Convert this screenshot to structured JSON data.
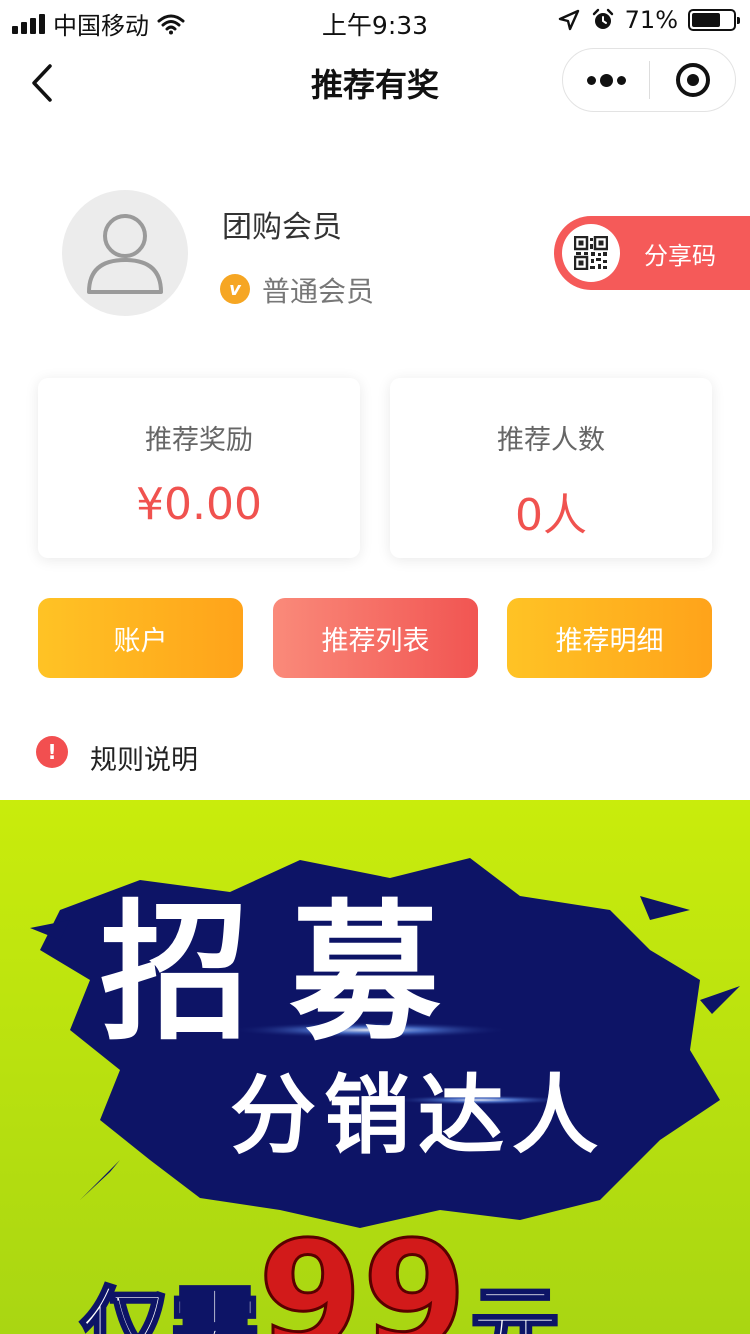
{
  "status_bar": {
    "carrier": "中国移动",
    "time": "上午9:33",
    "battery_percent": "71%",
    "battery_level": 0.71
  },
  "nav": {
    "title": "推荐有奖"
  },
  "profile": {
    "name": "团购会员",
    "badge_letter": "v",
    "member_level": "普通会员",
    "share_code_label": "分享码"
  },
  "stats": [
    {
      "label": "推荐奖励",
      "value": "¥0.00"
    },
    {
      "label": "推荐人数",
      "value": "0人"
    }
  ],
  "actions": [
    {
      "label": "账户"
    },
    {
      "label": "推荐列表"
    },
    {
      "label": "推荐明细"
    }
  ],
  "rules": {
    "icon_glyph": "!",
    "label": "规则说明"
  },
  "banner": {
    "headline": "招募",
    "subline": "分销达人",
    "price_prefix": "仅需",
    "price": "99",
    "price_unit": "元"
  },
  "colors": {
    "accent_red": "#f0524f",
    "button_orange": "#ffa31a",
    "banner_green": "#b8e40a",
    "splash_navy": "#0d1466"
  }
}
